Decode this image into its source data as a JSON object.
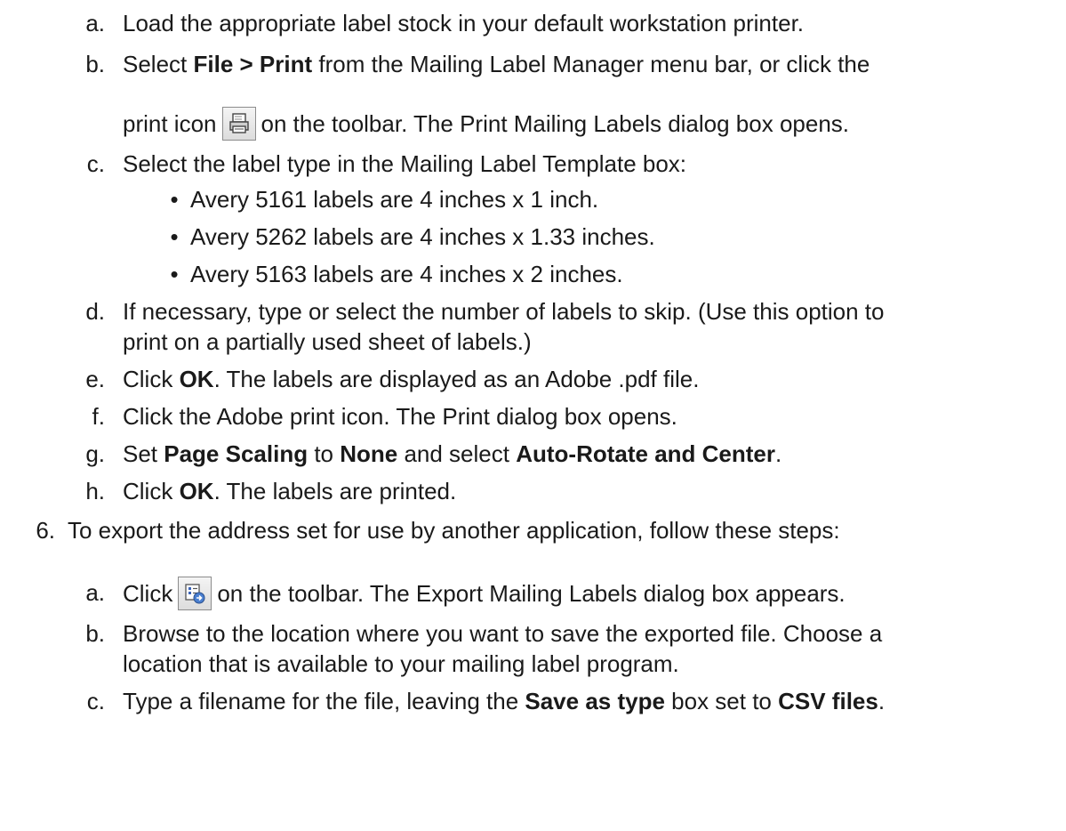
{
  "steps": {
    "a": {
      "marker": "a.",
      "text": "Load the appropriate label stock in your default workstation printer."
    },
    "b": {
      "marker": "b.",
      "pre": "Select ",
      "bold": "File > Print",
      "post": " from the Mailing Label Manager menu bar, or click the",
      "line2_pre": "print icon",
      "line2_post": "on the toolbar. The Print Mailing Labels dialog box opens."
    },
    "c": {
      "marker": "c.",
      "text": "Select the label type in the Mailing Label Template box:",
      "bullets": [
        "Avery 5161 labels are 4 inches x 1 inch.",
        "Avery 5262 labels are 4 inches x 1.33 inches.",
        "Avery 5163 labels are 4 inches x 2 inches."
      ]
    },
    "d": {
      "marker": "d.",
      "line1": "If necessary, type or select the number of labels to skip. (Use this option to",
      "line2": "print on a partially used sheet of labels.)"
    },
    "e": {
      "marker": "e.",
      "pre": "Click ",
      "bold": "OK",
      "post": ". The labels are displayed as an Adobe .pdf file."
    },
    "f": {
      "marker": "f.",
      "text": "Click the Adobe print icon. The Print dialog box opens."
    },
    "g": {
      "marker": "g.",
      "pre": "Set ",
      "bold1": "Page Scaling",
      "mid1": " to ",
      "bold2": "None",
      "mid2": " and select ",
      "bold3": "Auto-Rotate and Center",
      "post": "."
    },
    "h": {
      "marker": "h.",
      "pre": "Click ",
      "bold": "OK",
      "post": ". The labels are printed."
    }
  },
  "step6": {
    "marker": "6.",
    "text": "To export the address set for use by another application, follow these steps:",
    "a": {
      "marker": "a.",
      "pre": "Click",
      "post": "on the toolbar. The Export Mailing Labels dialog box appears."
    },
    "b": {
      "marker": "b.",
      "line1": "Browse to the location where you want to save the exported file. Choose a",
      "line2": "location that is available to your mailing label program."
    },
    "c": {
      "marker": "c.",
      "pre": "Type a filename for the file, leaving the ",
      "bold1": "Save as type",
      "mid": " box set to ",
      "bold2": "CSV files",
      "post": "."
    }
  },
  "icons": {
    "print": "printer-icon",
    "export": "export-icon"
  },
  "colors": {
    "text": "#1a1a1a",
    "icon_border": "#8c8c8c"
  }
}
